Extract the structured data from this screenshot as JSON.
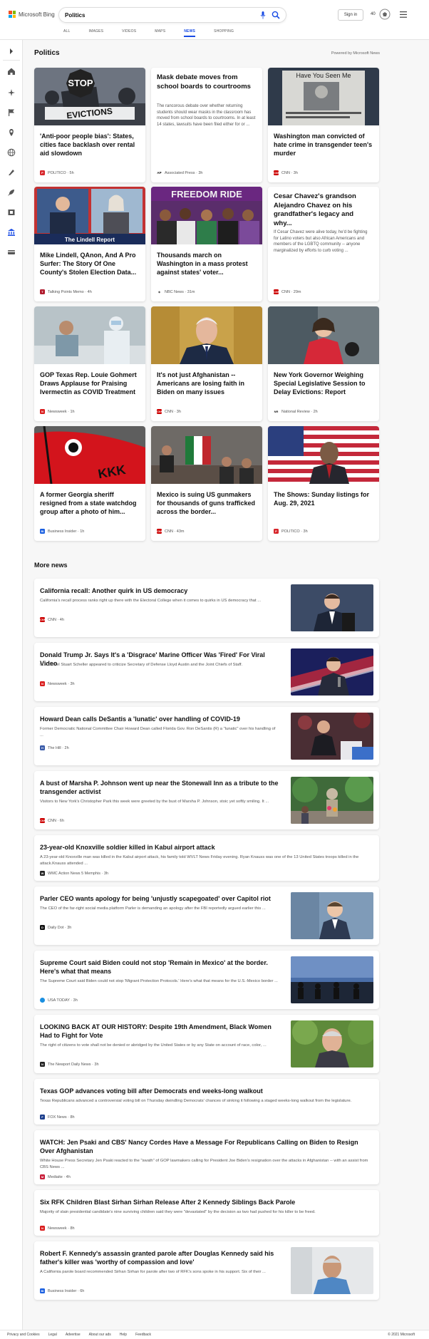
{
  "header": {
    "logo_text": "Microsoft Bing",
    "search_value": "Politics",
    "signin_label": "Sign in",
    "points": "40"
  },
  "tabs": [
    {
      "label": "ALL"
    },
    {
      "label": "IMAGES"
    },
    {
      "label": "VIDEOS"
    },
    {
      "label": "MAPS"
    },
    {
      "label": "NEWS",
      "active": true
    },
    {
      "label": "SHOPPING"
    }
  ],
  "section": {
    "title": "Politics",
    "powered": "Powered by Microsoft News"
  },
  "cards": [
    {
      "title": "'Anti-poor people bias': States, cities face backlash over rental aid slowdown",
      "source": "POLITICO · 5h"
    },
    {
      "title": "Mask debate moves from school boards to courtrooms",
      "snippet": "The rancorous debate over whether returning students should wear masks in the classroom has moved from school boards to courtrooms. In at least 14 states, lawsuits have been filed either for or ...",
      "source": "Associated Press · 3h"
    },
    {
      "title": "Washington man convicted of hate crime in transgender teen's murder",
      "source": "CNN · 3h"
    },
    {
      "title": "Mike Lindell, QAnon, And A Pro Surfer: The Story Of One County's Stolen Election Data...",
      "source": "Talking Points Memo · 4h"
    },
    {
      "title": "Thousands march on Washington in a mass protest against states' voter...",
      "source": "NBC News · 31m"
    },
    {
      "title": "Cesar Chavez's grandson Alejandro Chavez on his grandfather's legacy and why...",
      "snippet": "If Cesar Chavez were alive today, he'd be fighting for Latino voters but also African Americans and members of the LGBTQ community -- anyone marginalized by efforts to curb voting ...",
      "source": "CNN · 29m"
    },
    {
      "title": "GOP Texas Rep. Louie Gohmert Draws Applause for Praising Ivermectin as COVID Treatment",
      "source": "Newsweek · 1h"
    },
    {
      "title": "It's not just Afghanistan -- Americans are losing faith in Biden on many issues",
      "source": "CNN · 3h"
    },
    {
      "title": "New York Governor Weighing Special Legislative Session to Delay Evictions: Report",
      "source": "National Review · 2h"
    },
    {
      "title": "A former Georgia sheriff resigned from a state watchdog group after a photo of him...",
      "source": "Business Insider · 1h"
    },
    {
      "title": "Mexico is suing US gunmakers for thousands of guns trafficked across the border...",
      "source": "CNN · 43m"
    },
    {
      "title": "The Shows: Sunday listings for Aug. 29, 2021",
      "source": "POLITICO · 3h"
    }
  ],
  "images": {
    "stop_sign": "STOP",
    "evictions": "EVICTIONS",
    "poster_text": "Have You Seen Me",
    "lindell_report": "The Lindell Report",
    "freedom_ride": "FREEDOM RIDE",
    "kkk": "KKK"
  },
  "more": {
    "title": "More news",
    "items": [
      {
        "title": "California recall: Another quirk in US democracy",
        "snippet": "California's recall process ranks right up there with the Electoral College when it comes to quirks in US democracy that ...",
        "source": "CNN · 4h"
      },
      {
        "title": "Donald Trump Jr. Says It's a 'Disgrace' Marine Officer Was 'Fired' For Viral Video",
        "snippet": "Lt. Colonel Stuart Scheller appeared to criticize Secretary of Defense Lloyd Austin and the Joint Chiefs of Staff.",
        "source": "Newsweek · 3h"
      },
      {
        "title": "Howard Dean calls DeSantis a 'lunatic' over handling of COVID-19",
        "snippet": "Former Democratic National Committee Chair Howard Dean called Florida Gov. Ron DeSantis (R) a \"lunatic\" over his handling of ...",
        "source": "The Hill · 2h"
      },
      {
        "title": "A bust of Marsha P. Johnson went up near the Stonewall Inn as a tribute to the transgender activist",
        "snippet": "Visitors to New York's Christopher Park this week were greeted by the bust of Marsha P. Johnson, stoic yet softly smiling. It ...",
        "source": "CNN · 6h"
      },
      {
        "title": "23-year-old Knoxville soldier killed in Kabul airport attack",
        "snippet": "A 23-year-old Knoxville man was killed in the Kabul airport attack, his family told WVLT News Friday evening. Ryan Knauss was one of the 13 United States troops killed in the attack.Knauss attended ...",
        "source": "WMC Action News 5 Memphis · 3h"
      },
      {
        "title": "Parler CEO wants apology for being 'unjustly scapegoated' over Capitol riot",
        "snippet": "The CEO of the far-right social media platform Parler is demanding an apology after the FBI reportedly argued earlier this ...",
        "source": "Daily Dot · 3h"
      },
      {
        "title": "Supreme Court said Biden could not stop 'Remain in Mexico' at the border. Here's what that means",
        "snippet": "The Supreme Court said Biden could not stop 'Migrant Protection Protocols.' Here's what that means for the U.S.-Mexico border ...",
        "source": "USA TODAY · 3h"
      },
      {
        "title": "LOOKING BACK AT OUR HISTORY: Despite 19th Amendment, Black Women Had to Fight for Vote",
        "snippet": "The right of citizens to vote shall not be denied or abridged by the United States or by any State on account of race, color, ...",
        "source": "The Newport Daily News · 3h"
      },
      {
        "title": "Texas GOP advances voting bill after Democrats end weeks-long walkout",
        "snippet": "Texas Republicans advanced a controversial voting bill on Thursday dwindling Democrats' chances of sinking it following a staged weeks-long walkout from the legislature.",
        "source": "FOX News · 8h"
      },
      {
        "title": "WATCH: Jen Psaki and CBS' Nancy Cordes Have a Message For Republicans Calling on Biden to Resign Over Afghanistan",
        "snippet": "White House Press Secretary Jen Psaki reacted to the \"swath\" of GOP lawmakers calling for President Joe Biden's resignation over the attacks in Afghanistan -- with an assist from CBS News ...",
        "source": "Mediaite · 4h"
      },
      {
        "title": "Six RFK Children Blast Sirhan Sirhan Release After 2 Kennedy Siblings Back Parole",
        "snippet": "Majority of slain presidential candidate's nine surviving children said they were \"devastated\" by the decision as two had pushed for his killer to be freed.",
        "source": "Newsweek · 8h"
      },
      {
        "title": "Robert F. Kennedy's assassin granted parole after Douglas Kennedy said his father's killer was 'worthy of compassion and love'",
        "snippet": "A California parole board recommended Sirhan Sirhan for parole after two of RFK's sons spoke in his support. Six of their ...",
        "source": "Business Insider · 6h"
      }
    ]
  },
  "footer": {
    "links": [
      "Privacy and Cookies",
      "Legal",
      "Advertise",
      "About our ads",
      "Help",
      "Feedback"
    ],
    "copyright": "© 2021 Microsoft"
  }
}
